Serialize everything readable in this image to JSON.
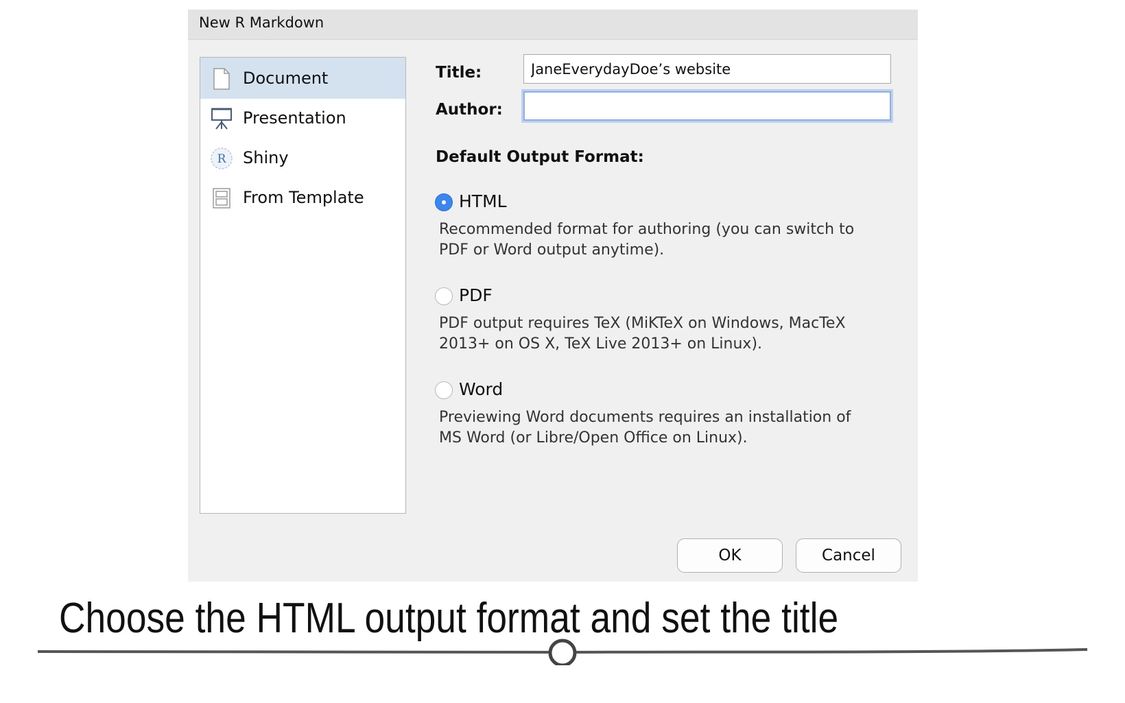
{
  "dialog": {
    "title": "New R Markdown",
    "sidebar": {
      "items": [
        {
          "label": "Document",
          "icon": "document-icon",
          "selected": true
        },
        {
          "label": "Presentation",
          "icon": "presentation-icon",
          "selected": false
        },
        {
          "label": "Shiny",
          "icon": "shiny-r-icon",
          "selected": false
        },
        {
          "label": "From Template",
          "icon": "template-icon",
          "selected": false
        }
      ]
    },
    "form": {
      "title_label": "Title:",
      "title_value": "JaneEverydayDoe’s website",
      "author_label": "Author:",
      "author_value": "",
      "output_heading": "Default Output Format:"
    },
    "formats": [
      {
        "label": "HTML",
        "checked": true,
        "description_line1": "Recommended format for authoring (you can switch to",
        "description_line2": "PDF or Word output anytime)."
      },
      {
        "label": "PDF",
        "checked": false,
        "description_line1": "PDF output requires TeX (MiKTeX on Windows, MacTeX",
        "description_line2": "2013+ on OS X, TeX Live 2013+ on Linux)."
      },
      {
        "label": "Word",
        "checked": false,
        "description_line1": "Previewing Word documents requires an installation of",
        "description_line2": "MS Word (or Libre/Open Office on Linux)."
      }
    ],
    "buttons": {
      "ok": "OK",
      "cancel": "Cancel"
    }
  },
  "caption": "Choose the HTML output format and set the title",
  "colors": {
    "accent": "#3d86ee",
    "selection": "#d4e1ef",
    "dialog_bg": "#f0f0f0"
  }
}
